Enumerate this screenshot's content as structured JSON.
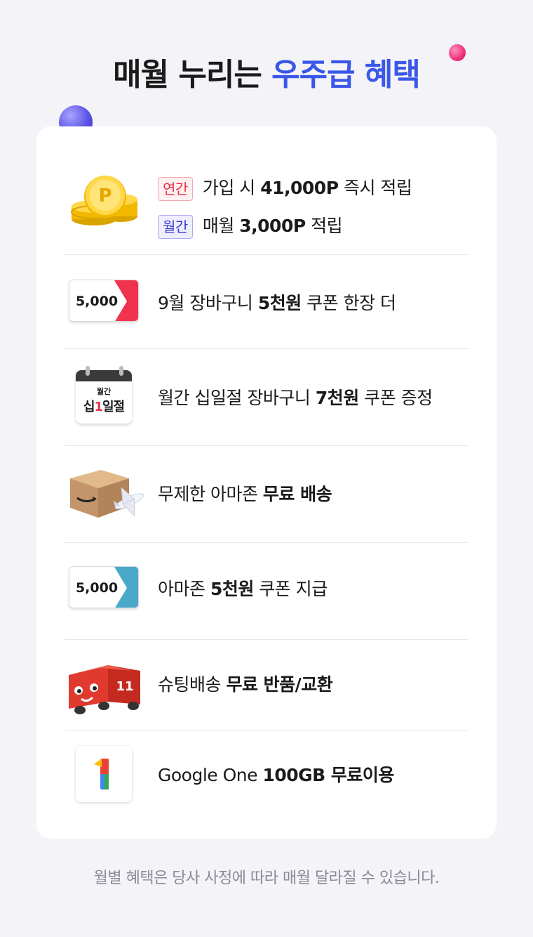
{
  "header": {
    "title_main": "매월 누리는 ",
    "title_highlight": "우주급 혜택"
  },
  "benefits": {
    "points": {
      "icon": "gold-coins-icon",
      "yearly_tag": "연간",
      "yearly_pre": "가입 시 ",
      "yearly_bold": "41,000P",
      "yearly_post": " 즉시 적립",
      "monthly_tag": "월간",
      "monthly_pre": "매월 ",
      "monthly_bold": "3,000P",
      "monthly_post": " 적립"
    },
    "cart_coupon": {
      "coupon_value": "5,000",
      "pre": "9월 장바구니 ",
      "bold": "5천원",
      "post": " 쿠폰 한장 더"
    },
    "calendar_coupon": {
      "cal_small": "월간",
      "cal_big_a": "십",
      "cal_big_one": "1",
      "cal_big_b": "일절",
      "pre": "월간 십일절 장바구니 ",
      "bold": "7천원",
      "post": " 쿠폰 증정"
    },
    "amazon_shipping": {
      "icon": "amazon-box-plane-icon",
      "pre": "무제한 아마존 ",
      "bold": "무료 배송"
    },
    "amazon_coupon": {
      "coupon_value": "5,000",
      "pre": "아마존 ",
      "bold": "5천원",
      "post": " 쿠폰 지급"
    },
    "shooting_return": {
      "icon": "red-delivery-truck-icon",
      "pre": "슈팅배송 ",
      "bold": "무료 반품/교환"
    },
    "google_one": {
      "icon": "google-one-icon",
      "pre": "Google One ",
      "bold": "100GB 무료이용"
    }
  },
  "footnote": "월별 혜택은 당사 사정에 따라 매월 달라질 수 있습니다.",
  "colors": {
    "accent_blue": "#3a57e8",
    "accent_red": "#e8334a",
    "coupon_blue": "#4aa8c8"
  }
}
